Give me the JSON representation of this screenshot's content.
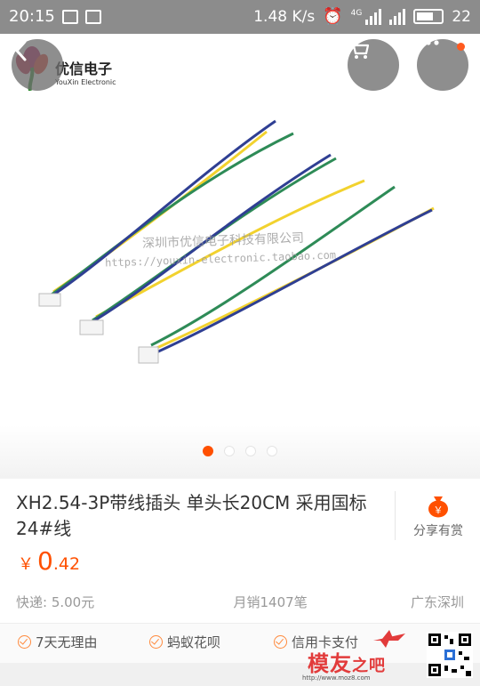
{
  "status_bar": {
    "time": "20:15",
    "net_speed": "1.48 K/s",
    "network": "4G",
    "battery": "22"
  },
  "header": {
    "logo_text": "优信电子",
    "logo_sub": "YouXin Electronic",
    "back_icon": "chevron-left-icon",
    "cart_icon": "cart-icon",
    "more_icon": "more-icon"
  },
  "gallery": {
    "watermark_cn": "深圳市优信电子科技有限公司",
    "watermark_url": "https://youxin-electronic.taobao.com",
    "pages": 4,
    "active_page": 1
  },
  "product": {
    "title": "XH2.54-3P带线插头  单头长20CM  采用国标24#线",
    "price_currency": "￥",
    "price_integer": "0",
    "price_decimal": ".42",
    "shipping": "快递: 5.00元",
    "monthly_sales": "月销1407笔",
    "location": "广东深圳"
  },
  "share": {
    "label": "分享有赏",
    "icon_glyph": "￥"
  },
  "guarantees": [
    {
      "label": "7天无理由"
    },
    {
      "label": "蚂蚁花呗"
    },
    {
      "label": "信用卡支付"
    }
  ],
  "watermark_site": {
    "text_main": "模友",
    "text_tail": "之吧",
    "url": "http://www.moz8.com"
  },
  "colors": {
    "accent": "#ff5000",
    "wire_blue": "#2f3f93",
    "wire_green": "#2e8b57",
    "wire_yellow": "#f2d22e"
  }
}
